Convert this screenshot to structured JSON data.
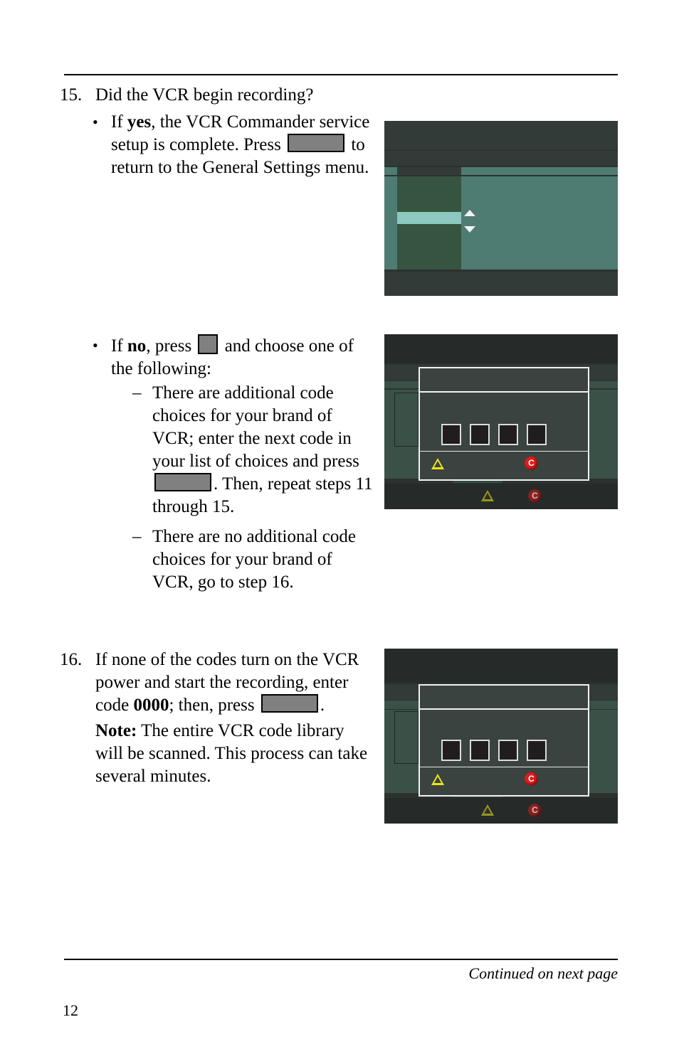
{
  "page": {
    "number": "12",
    "continued_note": "Continued on next page"
  },
  "steps": [
    {
      "number": "15.",
      "heading": "Did the VCR begin recording?",
      "bullets": [
        {
          "marker": "•",
          "run": [
            {
              "t": "If "
            },
            {
              "t": "yes",
              "bold": true
            },
            {
              "t": ", the VCR Commander service setup is complete. Press "
            },
            {
              "redact": "wide"
            },
            {
              "t": " to return to the General Settings menu."
            }
          ]
        },
        {
          "marker": "•",
          "run": [
            {
              "t": "If "
            },
            {
              "t": "no",
              "bold": true
            },
            {
              "t": ", press "
            },
            {
              "redact": "small"
            },
            {
              "t": " and choose one of the following:"
            }
          ],
          "subitems": [
            {
              "marker": "–",
              "run": [
                {
                  "t": "There are additional code choices for your brand of VCR; enter the next code in your list of choices and press "
                },
                {
                  "redact": "wide"
                },
                {
                  "t": ". Then, repeat steps 11 through 15."
                }
              ]
            },
            {
              "marker": "–",
              "run": [
                {
                  "t": "There are no additional code choices for your brand of VCR, go to step 16."
                }
              ]
            }
          ]
        }
      ]
    },
    {
      "number": "16.",
      "heading": "",
      "body_runs": [
        [
          {
            "t": "If none of the codes turn on the VCR power and start the recording, enter code "
          },
          {
            "t": "0000",
            "bold": true
          },
          {
            "t": "; then, press "
          },
          {
            "redact": "wide"
          },
          {
            "t": "."
          }
        ],
        [
          {
            "t": "Note:",
            "bold": true
          },
          {
            "t": " The entire VCR code library will be scanned. This process can take several minutes."
          }
        ]
      ]
    }
  ],
  "screenshots": [
    {
      "id": "menu-list-screen",
      "caption": "",
      "kind": "tv-menu-list",
      "colors": {
        "chrome_dark": "#333b39",
        "panel_teal": "#4e7b72",
        "list_green": "#375440",
        "highlight": "#8cc7c0",
        "arrow": "#f2f2f2"
      },
      "scroll_up_icon": "triangle-up-icon",
      "scroll_down_icon": "triangle-down-icon"
    },
    {
      "id": "code-entry-screen-a",
      "caption": "",
      "kind": "tv-code-dialog",
      "code_digit_count": 4,
      "code_digits": [
        "",
        "",
        "",
        ""
      ],
      "warning_icon": "warning-triangle-icon",
      "record_icon": "record-c-icon",
      "record_icon_letter": "C",
      "colors": {
        "chrome_dark": "#262b29",
        "chrome_mid": "#333b39",
        "panel_green": "#3a5148",
        "dialog_bg": "#3a4340",
        "dialog_border": "#f2f2f2",
        "digit_box": "#201d1f",
        "warning_yellow": "#ece31a",
        "record_red": "#e01b1b"
      }
    },
    {
      "id": "code-entry-screen-b",
      "caption": "",
      "kind": "tv-code-dialog",
      "code_digit_count": 4,
      "code_digits": [
        "",
        "",
        "",
        ""
      ],
      "warning_icon": "warning-triangle-icon",
      "record_icon": "record-c-icon",
      "record_icon_letter": "C",
      "colors": {
        "chrome_dark": "#262b29",
        "chrome_mid": "#333b39",
        "panel_green": "#3a5148",
        "dialog_bg": "#3a4340",
        "dialog_border": "#f2f2f2",
        "digit_box": "#201d1f",
        "warning_yellow": "#ece31a",
        "record_red": "#e01b1b"
      }
    }
  ]
}
